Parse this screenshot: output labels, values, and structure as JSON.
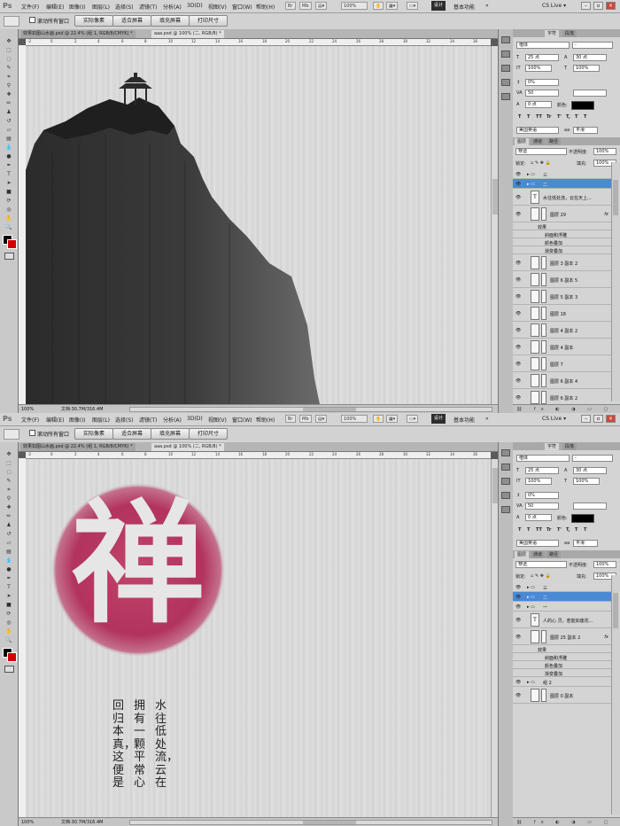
{
  "screens": [
    {
      "menubar": {
        "logo": "Ps",
        "items": [
          "文件(F)",
          "编辑(E)",
          "图像(I)",
          "图层(L)",
          "选择(S)",
          "滤镜(T)",
          "分析(A)",
          "3D(D)",
          "视图(V)",
          "窗口(W)",
          "帮助(H)"
        ],
        "zoom_value": "100%",
        "workspace_active": "设计",
        "workspace_other": "基本功能",
        "more": "»",
        "cs_live": "CS Live ▾"
      },
      "options": {
        "checkbox_label": "滚动所有窗口",
        "buttons": [
          "实际像素",
          "适合屏幕",
          "填充屏幕",
          "打印尺寸"
        ]
      },
      "tabs": [
        "效果如图山水画.psd @ 22.4% (组 1, RGB/8/CMYK) *",
        "aaa.psd @ 100% (二, RGB/8) *"
      ],
      "ruler_top": [
        "-2",
        "0",
        "2",
        "4",
        "6",
        "8",
        "10",
        "12",
        "14",
        "16",
        "18",
        "20",
        "22",
        "24",
        "26",
        "28",
        "30",
        "32",
        "34",
        "36"
      ],
      "status": {
        "zoom": "100%",
        "doc": "文档:30.7M/316.4M"
      },
      "character": {
        "tabs": [
          "字符",
          "段落"
        ],
        "font_family": "楷体",
        "font_style": "-",
        "font_size": "25 点",
        "leading": "30 点",
        "vscale": "100%",
        "hscale": "100%",
        "baseline": "0%",
        "tracking": "50",
        "shift": "0 点",
        "color_label": "颜色:",
        "style_buttons": [
          "T",
          "T",
          "TT",
          "Tr",
          "T'",
          "T,",
          "T",
          "T"
        ],
        "language": "美国英语",
        "aa": "aa",
        "aa_mode": "平滑"
      },
      "layers": {
        "tabs": [
          "图层",
          "通道",
          "路径"
        ],
        "blend": "穿透",
        "opacity_label": "不透明度:",
        "opacity": "100%",
        "lock_label": "锁定:",
        "fill_label": "填充:",
        "fill": "100%",
        "rows": [
          {
            "name": "三",
            "kind": "group",
            "selected": false,
            "fx": false
          },
          {
            "name": "二",
            "kind": "group",
            "selected": true,
            "fx": false
          },
          {
            "name": "水往低处流，云在天上...",
            "kind": "text",
            "selected": false,
            "fx": false
          },
          {
            "name": "图层 29",
            "kind": "layer",
            "selected": false,
            "fx": true
          },
          {
            "name": "效果",
            "kind": "effect",
            "selected": false,
            "fx": false
          },
          {
            "name": "斜面和浮雕",
            "kind": "effect",
            "selected": false,
            "fx": false
          },
          {
            "name": "颜色叠加",
            "kind": "effect",
            "selected": false,
            "fx": false
          },
          {
            "name": "渐变叠加",
            "kind": "effect",
            "selected": false,
            "fx": false
          },
          {
            "name": "图层 3 副本 2",
            "kind": "layer",
            "selected": false,
            "fx": false
          },
          {
            "name": "图层 6 副本 5",
            "kind": "layer",
            "selected": false,
            "fx": false
          },
          {
            "name": "图层 5 副本 3",
            "kind": "layer",
            "selected": false,
            "fx": false
          },
          {
            "name": "图层 18",
            "kind": "layer",
            "selected": false,
            "fx": false
          },
          {
            "name": "图层 4 副本 2",
            "kind": "layer",
            "selected": false,
            "fx": false
          },
          {
            "name": "图层 4 副本",
            "kind": "layer",
            "selected": false,
            "fx": false
          },
          {
            "name": "图层 7",
            "kind": "layer",
            "selected": false,
            "fx": false
          },
          {
            "name": "图层 6 副本 4",
            "kind": "layer",
            "selected": false,
            "fx": false
          },
          {
            "name": "图层 6 副本 2",
            "kind": "layer",
            "selected": false,
            "fx": false
          }
        ]
      }
    },
    {
      "menubar": {
        "logo": "Ps",
        "items": [
          "文件(F)",
          "编辑(E)",
          "图像(I)",
          "图层(L)",
          "选择(S)",
          "滤镜(T)",
          "分析(A)",
          "3D(D)",
          "视图(V)",
          "窗口(W)",
          "帮助(H)"
        ],
        "zoom_value": "100%",
        "workspace_active": "设计",
        "workspace_other": "基本功能",
        "more": "»",
        "cs_live": "CS Live ▾"
      },
      "options": {
        "checkbox_label": "滚动所有窗口",
        "buttons": [
          "实际像素",
          "适合屏幕",
          "填充屏幕",
          "打印尺寸"
        ]
      },
      "tabs": [
        "效果如图山水画.psd @ 22.4% (组 1, RGB/8/CMYK) *",
        "aaa.psd @ 100% (二, RGB/8) *"
      ],
      "ruler_top": [
        "-2",
        "0",
        "2",
        "4",
        "6",
        "8",
        "10",
        "12",
        "14",
        "16",
        "18",
        "20",
        "22",
        "24",
        "26",
        "28",
        "30",
        "32",
        "34",
        "36"
      ],
      "status": {
        "zoom": "100%",
        "doc": "文档:30.7M/316.4M"
      },
      "artwork": {
        "zen_char": "禅",
        "poem_col1": "水往低处流，云在",
        "poem_col2": "拥有一颗平常心",
        "poem_col3": "回归本真，这便是"
      },
      "character": {
        "tabs": [
          "字符",
          "段落"
        ],
        "font_family": "楷体",
        "font_style": "-",
        "font_size": "25 点",
        "leading": "30 点",
        "vscale": "100%",
        "hscale": "100%",
        "baseline": "0%",
        "tracking": "50",
        "shift": "0 点",
        "color_label": "颜色:",
        "style_buttons": [
          "T",
          "T",
          "TT",
          "Tr",
          "T'",
          "T,",
          "T",
          "T"
        ],
        "language": "美国英语",
        "aa": "aa",
        "aa_mode": "平滑"
      },
      "layers": {
        "tabs": [
          "图层",
          "通道",
          "路径"
        ],
        "blend": "穿透",
        "opacity_label": "不透明度:",
        "opacity": "100%",
        "lock_label": "锁定:",
        "fill_label": "填充:",
        "fill": "100%",
        "rows": [
          {
            "name": "三",
            "kind": "group",
            "selected": false,
            "fx": false
          },
          {
            "name": "二",
            "kind": "group",
            "selected": true,
            "fx": false
          },
          {
            "name": "一",
            "kind": "group",
            "selected": false,
            "fx": false
          },
          {
            "name": "人的心 灵，若能如莲花...",
            "kind": "text",
            "selected": false,
            "fx": false
          },
          {
            "name": "图层 25 副本 2",
            "kind": "layer",
            "selected": false,
            "fx": true
          },
          {
            "name": "效果",
            "kind": "effect",
            "selected": false,
            "fx": false
          },
          {
            "name": "斜面和浮雕",
            "kind": "effect",
            "selected": false,
            "fx": false
          },
          {
            "name": "颜色叠加",
            "kind": "effect",
            "selected": false,
            "fx": false
          },
          {
            "name": "渐变叠加",
            "kind": "effect",
            "selected": false,
            "fx": false
          },
          {
            "name": "组 2",
            "kind": "group",
            "selected": false,
            "fx": false
          },
          {
            "name": "图层 0 副本",
            "kind": "layer",
            "selected": false,
            "fx": false
          }
        ]
      }
    }
  ],
  "colors": {
    "accent": "#4a89d4",
    "seal": "#b2335e",
    "ink": "#2f2f2f",
    "fg": "#000000",
    "bg": "#d20000"
  }
}
